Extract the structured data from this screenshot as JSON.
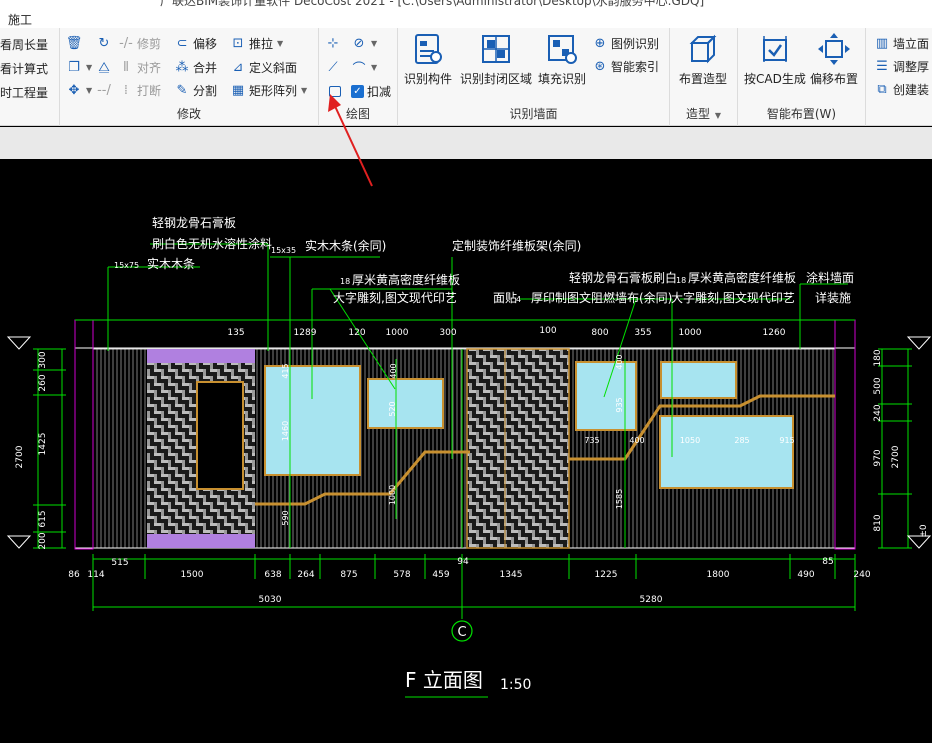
{
  "window": {
    "title": "广联达BIM装饰计量软件 DecoCost 2021 - [C:\\Users\\Administrator\\Desktop\\水韵服务中心.GDQ]"
  },
  "ribbon": {
    "tab": "施工",
    "partial": {
      "b1": "看周长量",
      "b2": "看计算式",
      "b3": "时工程量"
    },
    "modify": {
      "label": "修改",
      "delete": "",
      "rotate": "",
      "trim": "修剪",
      "offset": "偏移",
      "push": "推拉",
      "copy": "",
      "mirror": "",
      "align": "对齐",
      "merge": "合并",
      "define_slope": "定义斜面",
      "move": "",
      "break_label": "打断",
      "split": "分割",
      "rect_array": "矩形阵列"
    },
    "draw": {
      "label": "绘图",
      "deduct": "扣减"
    },
    "recog_wall": {
      "label": "识别墙面",
      "component": "识别构件",
      "closed": "识别封闭区域",
      "fill": "填充识别",
      "legend": "图例识别",
      "index": "智能索引"
    },
    "model": {
      "label": "造型",
      "layout": "布置造型"
    },
    "smart": {
      "label": "智能布置(W)",
      "cad_gen": "按CAD生成",
      "edit": "偏移布置"
    },
    "right": {
      "r1": "墙立面",
      "r2": "调整厚",
      "r3": "创建装"
    }
  },
  "drawing": {
    "notes": {
      "n1": "轻钢龙骨石膏板",
      "n2": "刷白色无机水溶性涂料",
      "n3": "实木木条",
      "n3s": "15x75",
      "n4": "实木木条(余同)",
      "n4s": "15x35",
      "n5": "定制装饰纤维板架(余同)",
      "n6": "厚米黄高密度纤维板",
      "n6s": "18",
      "n7": "大字雕刻,图文现代印艺",
      "n8": "面贴",
      "n8s": "4",
      "n9": "轻钢龙骨石膏板刷白",
      "n10": "厚印制图文阻燃墙布(余同)",
      "n11": "厚米黄高密度纤维板",
      "n11s": "18",
      "n12": "大字雕刻,图文现代印艺",
      "n13": "涂料墙面",
      "n14": "详装施"
    },
    "top_dims": [
      "135",
      "1289",
      "120",
      "1000",
      "300",
      "100",
      "800",
      "355",
      "1000",
      "1260"
    ],
    "bottom_dims": [
      "86",
      "114",
      "515",
      "1500",
      "638",
      "264",
      "875",
      "578",
      "459",
      "94",
      "1345",
      "1225",
      "1800",
      "490",
      "85",
      "240"
    ],
    "total_dims": [
      "5030",
      "5280"
    ],
    "left_dims": [
      "300",
      "260",
      "1425",
      "2700",
      "615",
      "200"
    ],
    "right_dims": [
      "180",
      "500",
      "240",
      "970",
      "2700",
      "810",
      "±0"
    ],
    "inner_dims": [
      "415",
      "400",
      "1460",
      "1000",
      "590",
      "520",
      "935",
      "735",
      "400",
      "1050",
      "285",
      "915",
      "1585",
      "400"
    ],
    "axis": "C",
    "title": "F 立面图",
    "scale": "1:50"
  }
}
